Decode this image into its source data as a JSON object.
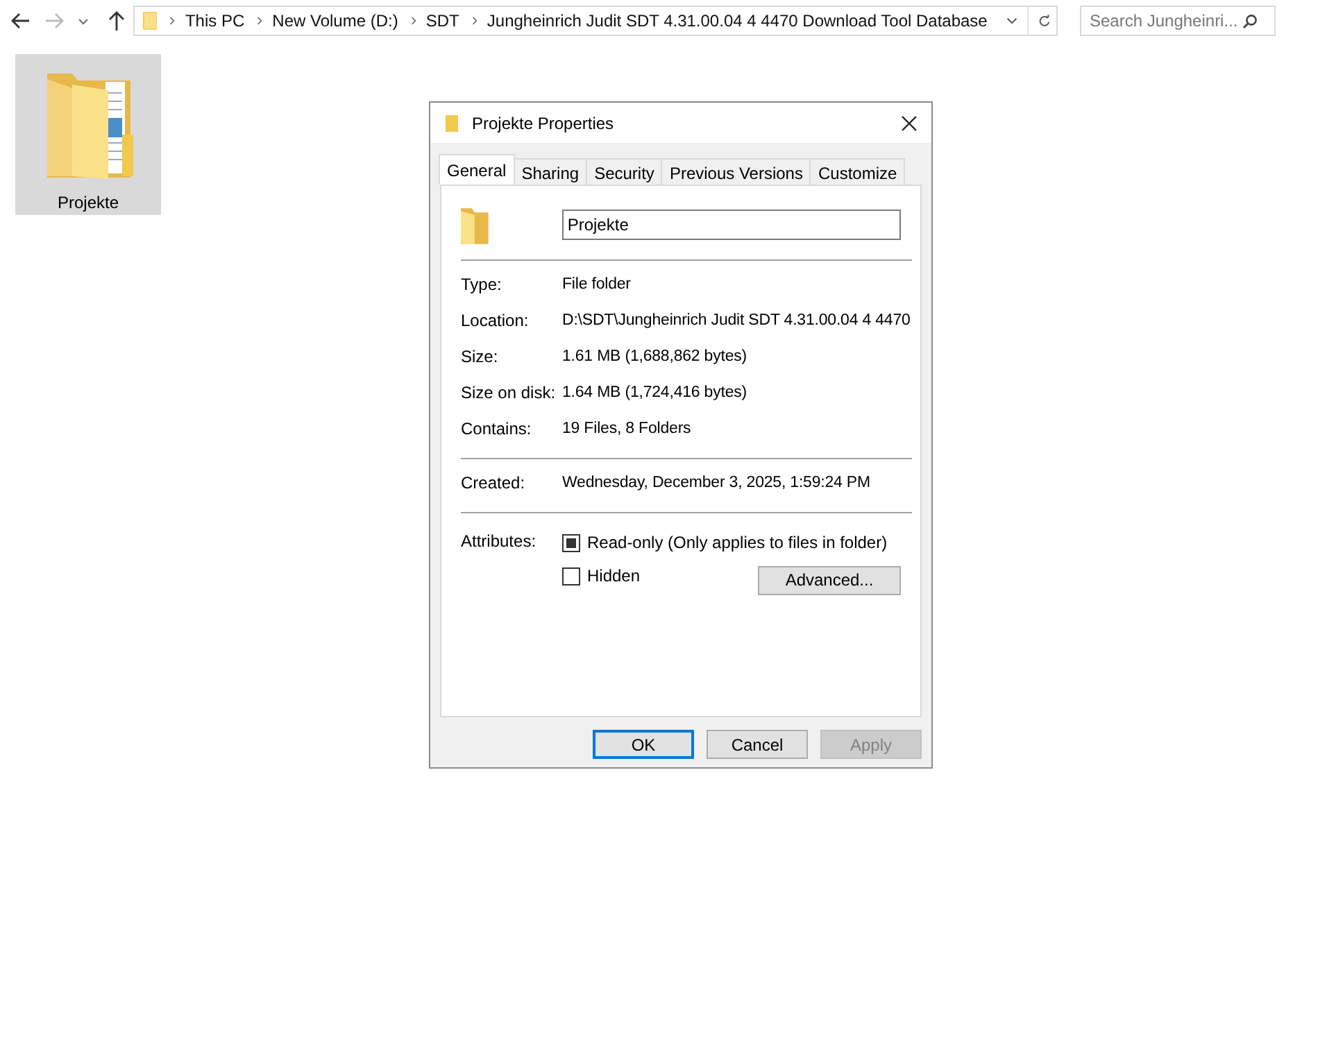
{
  "address_bar": {
    "crumbs": [
      "This PC",
      "New Volume (D:)",
      "SDT",
      "Jungheinrich Judit SDT 4.31.00.04 4 4470 Download Tool Database"
    ]
  },
  "search": {
    "placeholder": "Search Jungheinri..."
  },
  "items": [
    {
      "label": "Projekte",
      "selected": true
    }
  ],
  "dialog": {
    "title": "Projekte Properties",
    "tabs": [
      {
        "label": "General",
        "selected": true
      },
      {
        "label": "Sharing",
        "selected": false
      },
      {
        "label": "Security",
        "selected": false
      },
      {
        "label": "Previous Versions",
        "selected": false
      },
      {
        "label": "Customize",
        "selected": false
      }
    ],
    "name_field": {
      "value": "Projekte"
    },
    "groups": [
      [
        {
          "label": "Type:",
          "value": "File folder"
        },
        {
          "label": "Location:",
          "value": "D:\\SDT\\Jungheinrich Judit SDT 4.31.00.04 4 4470"
        },
        {
          "label": "Size:",
          "value": "1.61 MB (1,688,862 bytes)"
        },
        {
          "label": "Size on disk:",
          "value": "1.64 MB (1,724,416 bytes)"
        },
        {
          "label": "Contains:",
          "value": "19 Files, 8 Folders"
        }
      ],
      [
        {
          "label": "Created:",
          "value": "Wednesday, December 3, 2025, 1:59:24 PM"
        }
      ]
    ],
    "attributes_label": "Attributes:",
    "attributes": [
      {
        "label": "Read-only (Only applies to files in folder)",
        "checked": false,
        "indeterminate": true
      },
      {
        "label": "Hidden",
        "checked": false,
        "indeterminate": false
      }
    ],
    "advanced_button": "Advanced...",
    "buttons": [
      {
        "label": "OK",
        "default": true,
        "disabled": false
      },
      {
        "label": "Cancel",
        "default": false,
        "disabled": false
      },
      {
        "label": "Apply",
        "default": false,
        "disabled": true
      }
    ]
  }
}
